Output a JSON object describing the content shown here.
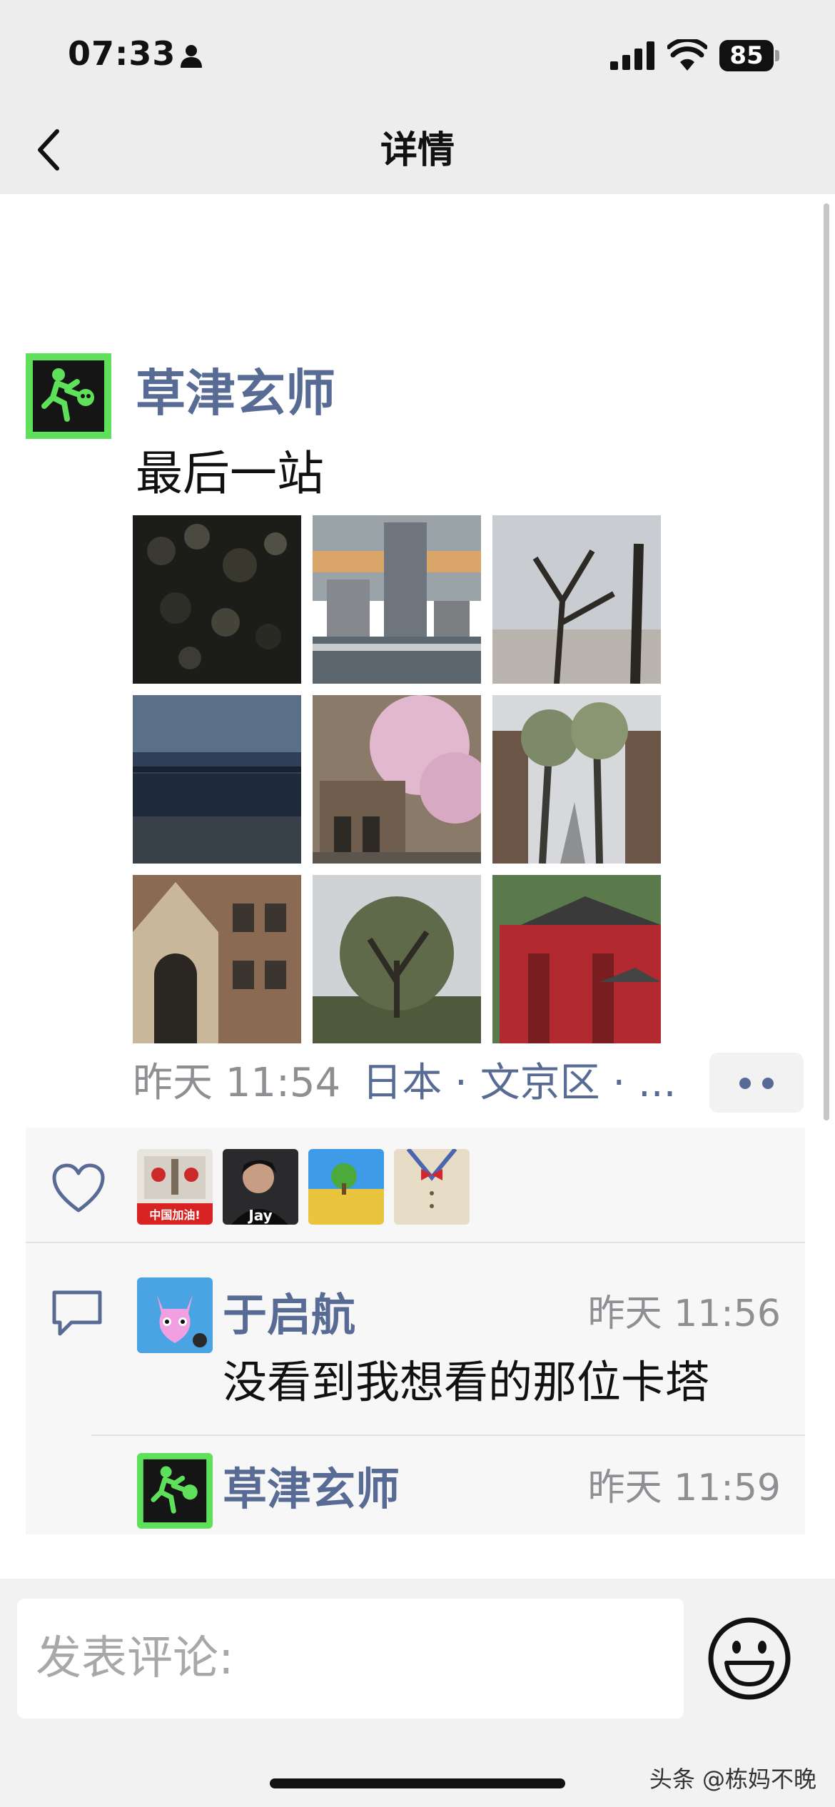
{
  "status_bar": {
    "time": "07:33",
    "battery": "85",
    "person_icon": "person-icon",
    "signal_icon": "signal-icon",
    "wifi_icon": "wifi-icon"
  },
  "nav": {
    "title": "详情",
    "back_icon": "chevron-left-icon"
  },
  "post": {
    "author": "草津玄师",
    "text": "最后一站",
    "time": "昨天 11:54",
    "location": "日本 · 文京区 · ...",
    "photo_count": 9,
    "accent_color": "#576b95",
    "more_icon": "more-dots-icon"
  },
  "likes": {
    "icon": "heart-icon",
    "avatars": [
      {
        "label": "中国加油!"
      },
      {
        "label": "Jay"
      },
      {
        "label": ""
      },
      {
        "label": ""
      }
    ]
  },
  "comments": {
    "icon": "comment-bubble-icon",
    "items": [
      {
        "author": "于启航",
        "time": "昨天 11:56",
        "text": "没看到我想看的那位卡塔"
      },
      {
        "author": "草津玄师",
        "time": "昨天 11:59",
        "text": ""
      }
    ]
  },
  "input": {
    "placeholder": "发表评论:",
    "emoji_icon": "emoji-smile-icon"
  },
  "watermark": "头条 @栋妈不晚"
}
